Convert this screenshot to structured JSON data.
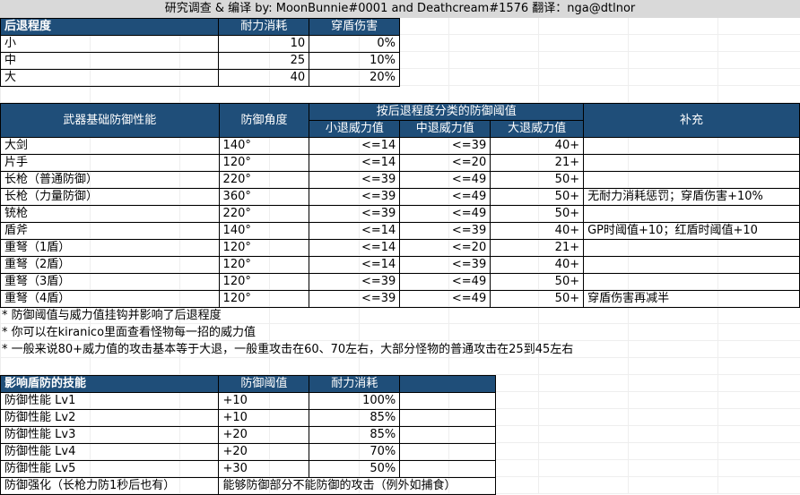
{
  "title": "研究调查 & 编译 by: MoonBunnie#0001 and Deathcream#1576      翻译：nga@dtlnor",
  "knockback": {
    "headers": [
      "后退程度",
      "耐力消耗",
      "穿盾伤害"
    ],
    "rows": [
      [
        "小",
        "10",
        "0%"
      ],
      [
        "中",
        "25",
        "10%"
      ],
      [
        "大",
        "40",
        "20%"
      ]
    ]
  },
  "weapons": {
    "header_name": "武器基础防御性能",
    "header_angle": "防御角度",
    "header_group": "按后退程度分类的防御阈值",
    "header_small": "小退威力值",
    "header_mid": "中退威力值",
    "header_large": "大退威力值",
    "header_note": "补充",
    "rows": [
      [
        "大剑",
        "140°",
        "<=14",
        "<=39",
        "40+",
        ""
      ],
      [
        "片手",
        "120°",
        "<=14",
        "<=20",
        "21+",
        ""
      ],
      [
        "长枪（普通防御）",
        "220°",
        "<=39",
        "<=49",
        "50+",
        ""
      ],
      [
        "长枪（力量防御）",
        "360°",
        "<=39",
        "<=49",
        "50+",
        "无耐力消耗惩罚；穿盾伤害+10%"
      ],
      [
        "铳枪",
        "220°",
        "<=39",
        "<=49",
        "50+",
        ""
      ],
      [
        "盾斧",
        "140°",
        "<=14",
        "<=39",
        "40+",
        "GP时阈值+10；红盾时阈值+10"
      ],
      [
        "重弩（1盾）",
        "120°",
        "<=14",
        "<=20",
        "21+",
        ""
      ],
      [
        "重弩（2盾）",
        "120°",
        "<=14",
        "<=39",
        "40+",
        ""
      ],
      [
        "重弩（3盾）",
        "120°",
        "<=39",
        "<=49",
        "50+",
        ""
      ],
      [
        "重弩（4盾）",
        "120°",
        "<=39",
        "<=49",
        "50+",
        "穿盾伤害再减半"
      ]
    ]
  },
  "notes": [
    "* 防御阈值与威力值挂钩并影响了后退程度",
    "* 你可以在kiranico里面查看怪物每一招的威力值",
    "* 一般来说80+威力值的攻击基本等于大退，一般重攻击在60、70左右，大部分怪物的普通攻击在25到45左右"
  ],
  "skills": {
    "headers": [
      "影响盾防的技能",
      "防御阈值",
      "耐力消耗"
    ],
    "rows": [
      [
        "防御性能 Lv1",
        "+10",
        "100%"
      ],
      [
        "防御性能 Lv2",
        "+10",
        "85%"
      ],
      [
        "防御性能 Lv3",
        "+20",
        "85%"
      ],
      [
        "防御性能 Lv4",
        "+20",
        "70%"
      ],
      [
        "防御性能 Lv5",
        "+30",
        "50%"
      ]
    ],
    "last_row": [
      "防御强化（长枪力防1秒后也有）",
      "能够防御部分不能防御的攻击（例外如捕食）"
    ]
  },
  "colors": {
    "header_bg": "#1f4e79",
    "title_bg": "#d9d9d9"
  }
}
